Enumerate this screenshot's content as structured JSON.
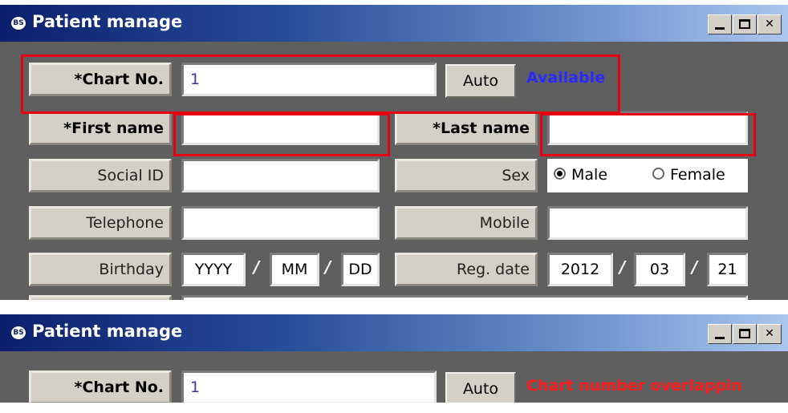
{
  "window_top": {
    "title": "Patient manage",
    "app_icon_text": "BS",
    "controls": {
      "minimize": "_",
      "maximize": "□",
      "close": "✕"
    },
    "chart_no": {
      "label": "*Chart No.",
      "value": "1",
      "button": "Auto",
      "status": "Available",
      "status_color": "#2a2aff"
    },
    "first_name": {
      "label": "*First name",
      "value": ""
    },
    "last_name": {
      "label": "*Last name",
      "value": ""
    },
    "social_id": {
      "label": "Social ID",
      "value": ""
    },
    "sex": {
      "label": "Sex",
      "options": [
        "Male",
        "Female"
      ],
      "selected": "Male"
    },
    "telephone": {
      "label": "Telephone",
      "value": ""
    },
    "mobile": {
      "label": "Mobile",
      "value": ""
    },
    "birthday": {
      "label": "Birthday",
      "year_placeholder": "YYYY",
      "month_placeholder": "MM",
      "day_placeholder": "DD"
    },
    "reg_date": {
      "label": "Reg. date",
      "year": "2012",
      "month": "03",
      "day": "21"
    },
    "date_separator": "/"
  },
  "window_bottom": {
    "title": "Patient manage",
    "app_icon_text": "BS",
    "controls": {
      "minimize": "_",
      "maximize": "□",
      "close": "✕"
    },
    "chart_no": {
      "label": "*Chart No.",
      "value": "1",
      "button": "Auto",
      "status": "Chart number overlappin",
      "status_color": "#ff1c1c"
    }
  },
  "highlight_color": "#e60012"
}
